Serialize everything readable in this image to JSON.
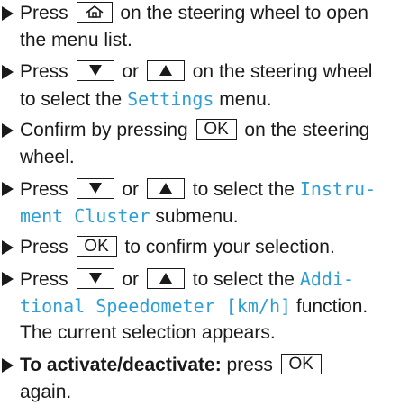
{
  "steps": [
    {
      "line1_a": "Press",
      "line1_b": "on the steering wheel to open",
      "line2": "the menu list."
    },
    {
      "line1_a": "Press",
      "line1_or": "or",
      "line1_b": "on the steering wheel",
      "line2_a": "to select the",
      "line2_display": "Settings",
      "line2_b": "menu."
    },
    {
      "line1_a": "Confirm by pressing",
      "line1_b": "on the steering",
      "line2": "wheel."
    },
    {
      "line1_a": "Press",
      "line1_or": "or",
      "line1_b": "to select the",
      "line1_display": "Instru-",
      "line2_display": "ment Cluster",
      "line2_b": "submenu."
    },
    {
      "line1_a": "Press",
      "line1_b": "to confirm your selection."
    },
    {
      "line1_a": "Press",
      "line1_or": "or",
      "line1_b": "to select the",
      "line1_display": "Addi-",
      "line2_display": "tional Speedometer [km/h]",
      "line2_b": "function.",
      "line3": "The current selection appears."
    },
    {
      "line1_bold": "To activate/deactivate:",
      "line1_b": "press",
      "line2": "again."
    }
  ],
  "keys": {
    "ok_label": "OK",
    "home_icon": "home-icon",
    "down_icon": "down-arrow-icon",
    "up_icon": "up-arrow-icon"
  },
  "colors": {
    "display_text": "#2e9fd3",
    "body_text": "#1a1a1a"
  }
}
